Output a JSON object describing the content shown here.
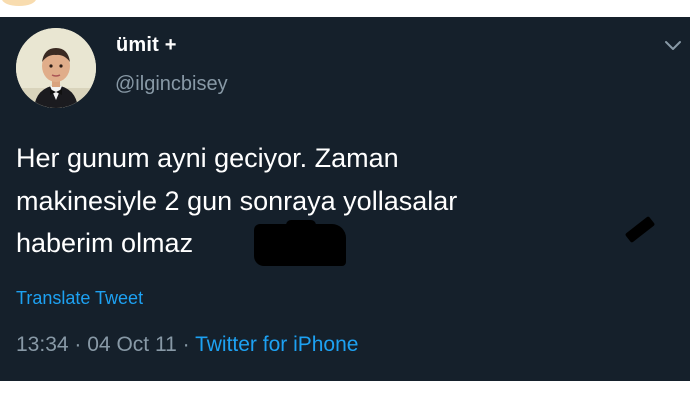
{
  "user": {
    "display_name": "ümit +",
    "handle": "@ilgincbisey"
  },
  "tweet": {
    "lines": [
      "Her gunum ayni geciyor. Zaman",
      "makinesiyle 2 gun sonraya yollasalar",
      "haberim olmaz"
    ],
    "translate_label": "Translate Tweet",
    "time": "13:34",
    "date": "04 Oct 11",
    "separator": "·",
    "source": "Twitter for iPhone"
  },
  "icons": {
    "menu": "chevron-down-icon"
  },
  "colors": {
    "background": "#15202b",
    "text": "#ffffff",
    "secondary": "#8899a6",
    "link": "#1da1f2"
  }
}
